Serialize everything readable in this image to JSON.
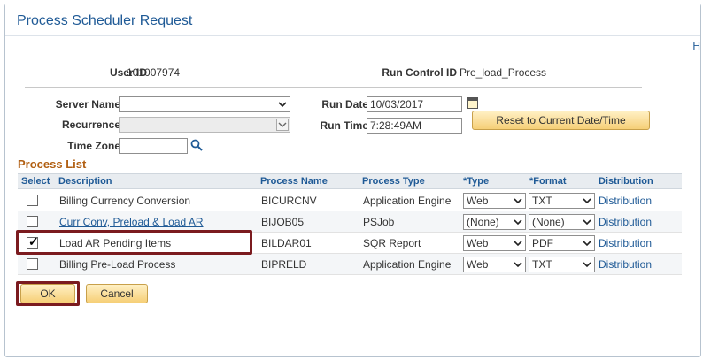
{
  "window": {
    "title": "Process Scheduler Request",
    "help_link": "H"
  },
  "header": {
    "user_id_label": "User ID",
    "user_id_value": "101007974",
    "run_control_label": "Run Control ID",
    "run_control_value": "Pre_load_Process"
  },
  "form": {
    "server_name_label": "Server Name",
    "server_name_value": "",
    "recurrence_label": "Recurrence",
    "recurrence_value": "",
    "time_zone_label": "Time Zone",
    "time_zone_value": "",
    "run_date_label": "Run Date",
    "run_date_value": "10/03/2017",
    "run_time_label": "Run Time",
    "run_time_value": "7:28:49AM",
    "reset_button": "Reset to Current Date/Time"
  },
  "process_list": {
    "title": "Process List",
    "columns": [
      "Select",
      "Description",
      "Process Name",
      "Process Type",
      "*Type",
      "*Format",
      "Distribution"
    ],
    "rows": [
      {
        "checked": false,
        "description": "Billing Currency Conversion",
        "description_is_link": false,
        "process_name": "BICURCNV",
        "process_type": "Application Engine",
        "type": "Web",
        "format": "TXT",
        "distribution": "Distribution"
      },
      {
        "checked": false,
        "description": "Curr Conv, Preload & Load AR",
        "description_is_link": true,
        "process_name": "BIJOB05",
        "process_type": "PSJob",
        "type": "(None)",
        "format": "(None)",
        "distribution": "Distribution"
      },
      {
        "checked": true,
        "description": "Load AR Pending Items",
        "description_is_link": false,
        "process_name": "BILDAR01",
        "process_type": "SQR Report",
        "type": "Web",
        "format": "PDF",
        "distribution": "Distribution"
      },
      {
        "checked": false,
        "description": "Billing Pre-Load Process",
        "description_is_link": false,
        "process_name": "BIPRELD",
        "process_type": "Application Engine",
        "type": "Web",
        "format": "TXT",
        "distribution": "Distribution"
      }
    ]
  },
  "buttons": {
    "ok": "OK",
    "cancel": "Cancel"
  },
  "colors": {
    "title_blue": "#1f5a96",
    "section_orange": "#b15f12",
    "callout_red": "#7b1b1f",
    "button_gold": "#f6cf77"
  }
}
